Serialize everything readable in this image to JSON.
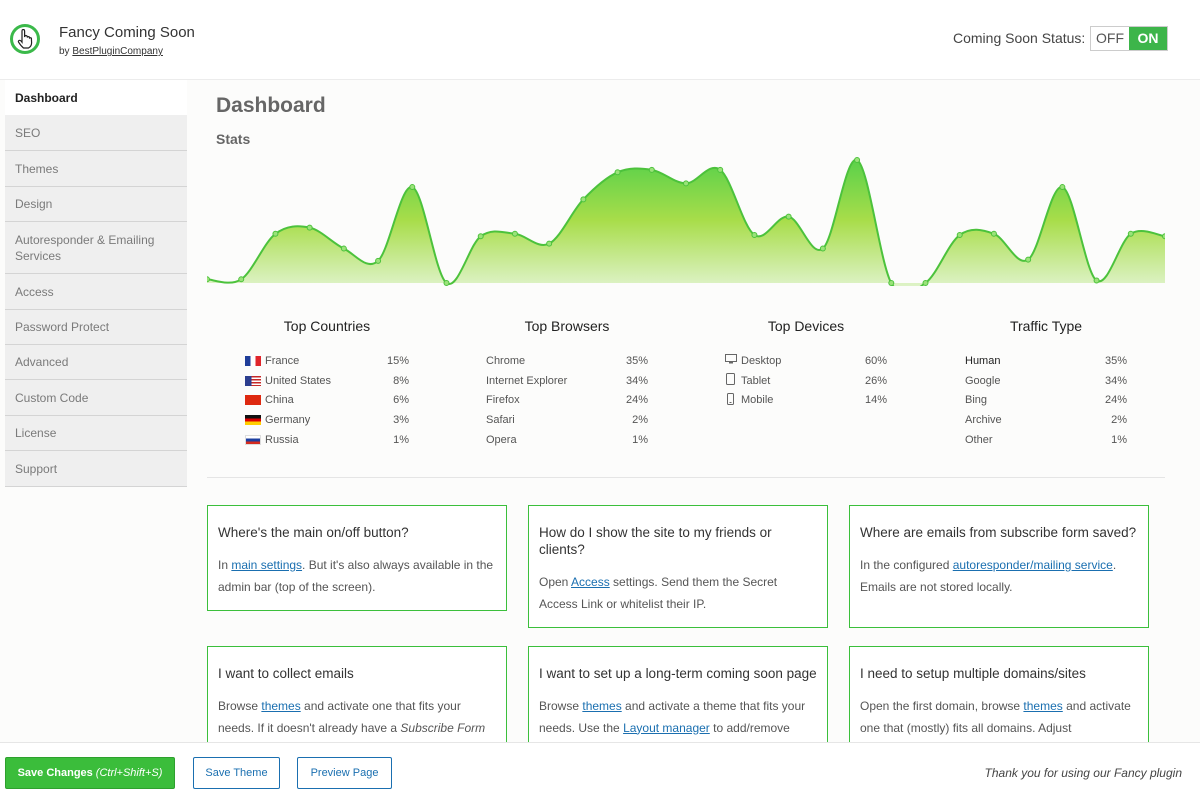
{
  "header": {
    "app_title": "Fancy Coming Soon",
    "by_prefix": "by",
    "by_link": "BestPluginCompany",
    "status_label": "Coming Soon Status:",
    "toggle_off": "OFF",
    "toggle_on": "ON",
    "toggle_state": "ON"
  },
  "sidebar": {
    "items": [
      {
        "label": "Dashboard",
        "active": true
      },
      {
        "label": "SEO"
      },
      {
        "label": "Themes"
      },
      {
        "label": "Design"
      },
      {
        "label": "Autoresponder & Emailing Services"
      },
      {
        "label": "Access"
      },
      {
        "label": "Password Protect"
      },
      {
        "label": "Advanced"
      },
      {
        "label": "Custom Code"
      },
      {
        "label": "License"
      },
      {
        "label": "Support"
      }
    ]
  },
  "main": {
    "title": "Dashboard",
    "stats_title": "Stats"
  },
  "chart_data": {
    "type": "area",
    "colors": {
      "line": "#4cc23c",
      "fill_top": "#5ad14a",
      "fill_mid": "#a8dd4a",
      "fill_bottom": "#e4f5d6"
    },
    "y": [
      3,
      3,
      40,
      45,
      28,
      18,
      78,
      0,
      38,
      40,
      32,
      68,
      90,
      92,
      81,
      92,
      39,
      54,
      28,
      100,
      0,
      0,
      39,
      40,
      19,
      78,
      2,
      40,
      38
    ]
  },
  "stats": {
    "countries": {
      "title": "Top Countries",
      "rows": [
        {
          "name": "France",
          "value": "15%",
          "flag": "fr"
        },
        {
          "name": "United States",
          "value": "8%",
          "flag": "us"
        },
        {
          "name": "China",
          "value": "6%",
          "flag": "cn"
        },
        {
          "name": "Germany",
          "value": "3%",
          "flag": "de"
        },
        {
          "name": "Russia",
          "value": "1%",
          "flag": "ru"
        }
      ]
    },
    "browsers": {
      "title": "Top Browsers",
      "rows": [
        {
          "name": "Chrome",
          "value": "35%"
        },
        {
          "name": "Internet Explorer",
          "value": "34%"
        },
        {
          "name": "Firefox",
          "value": "24%"
        },
        {
          "name": "Safari",
          "value": "2%"
        },
        {
          "name": "Opera",
          "value": "1%"
        }
      ]
    },
    "devices": {
      "title": "Top Devices",
      "rows": [
        {
          "name": "Desktop",
          "value": "60%",
          "icon": "desktop-icon"
        },
        {
          "name": "Tablet",
          "value": "26%",
          "icon": "tablet-icon"
        },
        {
          "name": "Mobile",
          "value": "14%",
          "icon": "mobile-icon"
        }
      ]
    },
    "traffic": {
      "title": "Traffic Type",
      "rows": [
        {
          "name": "Human",
          "value": "35%"
        },
        {
          "name": "Google",
          "value": "34%"
        },
        {
          "name": "Bing",
          "value": "24%"
        },
        {
          "name": "Archive",
          "value": "2%"
        },
        {
          "name": "Other",
          "value": "1%"
        }
      ]
    }
  },
  "cards": [
    {
      "title": "Where's the main on/off button?",
      "parts": [
        "In ",
        {
          "link": "main settings"
        },
        ". But it's also always available in the admin bar (top of the screen)."
      ]
    },
    {
      "title": "How do I show the site to my friends or clients?",
      "parts": [
        "Open ",
        {
          "link": "Access"
        },
        " settings. Send them the Secret Access Link or whitelist their IP."
      ]
    },
    {
      "title": "Where are emails from subscribe form saved?",
      "parts": [
        "In the configured ",
        {
          "link": "autoresponder/mailing service"
        },
        ". Emails are not stored locally."
      ]
    },
    {
      "title": "I want to collect emails",
      "parts": [
        "Browse ",
        {
          "link": "themes"
        },
        " and activate one that fits your needs. If it doesn't already have a ",
        {
          "em": "Subscribe Form"
        }
      ]
    },
    {
      "title": "I want to set up a long-term coming soon page",
      "parts": [
        "Browse ",
        {
          "link": "themes"
        },
        " and activate a theme that fits your needs. Use the ",
        {
          "link": "Layout manager"
        },
        " to add/remove"
      ]
    },
    {
      "title": "I need to setup multiple domains/sites",
      "parts": [
        "Open the first domain, browse ",
        {
          "link": "themes"
        },
        " and activate one that (mostly) fits all domains. Adjust"
      ]
    }
  ],
  "footer": {
    "save_label": "Save Changes",
    "save_shortcut": "(Ctrl+Shift+S)",
    "save_theme_label": "Save Theme",
    "preview_label": "Preview Page",
    "thanks": "Thank you for using our Fancy plugin"
  }
}
